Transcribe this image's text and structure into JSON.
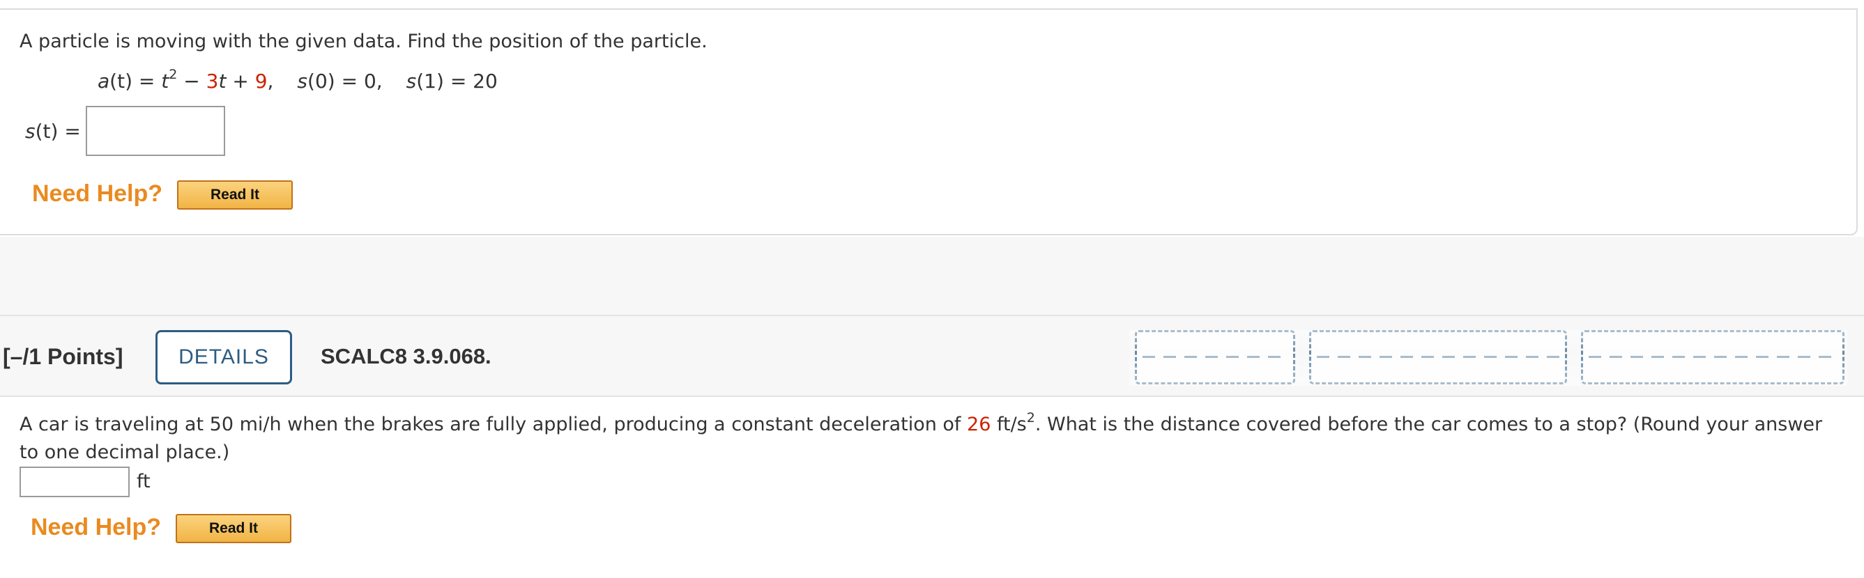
{
  "question1": {
    "prompt": "A particle is moving with the given data. Find the position of the particle.",
    "equation": {
      "a_label": "a",
      "a_arg": "(t) = ",
      "t_var": "t",
      "exponent": "2",
      "minus": " − ",
      "coef": "3",
      "t_var2": "t",
      "plus": " + ",
      "constant": "9",
      "comma": ",",
      "s0_label": "s",
      "s0_rest": "(0) = 0,",
      "s1_label": "s",
      "s1_rest": "(1) = 20"
    },
    "answer_label_var": "s",
    "answer_label_rest": "(t) =",
    "answer_value": "",
    "need_help": "Need Help?",
    "read_it": "Read It"
  },
  "question2": {
    "points": "[–/1 Points]",
    "details": "DETAILS",
    "code": "SCALC8 3.9.068.",
    "prompt_part1": "A car is traveling at 50 mi/h when the brakes are fully applied, producing a constant deceleration of ",
    "deceleration": "26",
    "prompt_part2": " ft/s",
    "prompt_exp": "2",
    "prompt_part3": ". What is the distance covered before the car comes to a stop? (Round your answer to one decimal place.)",
    "answer_value": "",
    "unit": "ft",
    "need_help": "Need Help?",
    "read_it": "Read It"
  },
  "colors": {
    "accent_blue": "#2d5c82",
    "highlight_red": "#cc2200",
    "help_orange": "#ea8a1f",
    "button_gold": "#f1b445"
  }
}
